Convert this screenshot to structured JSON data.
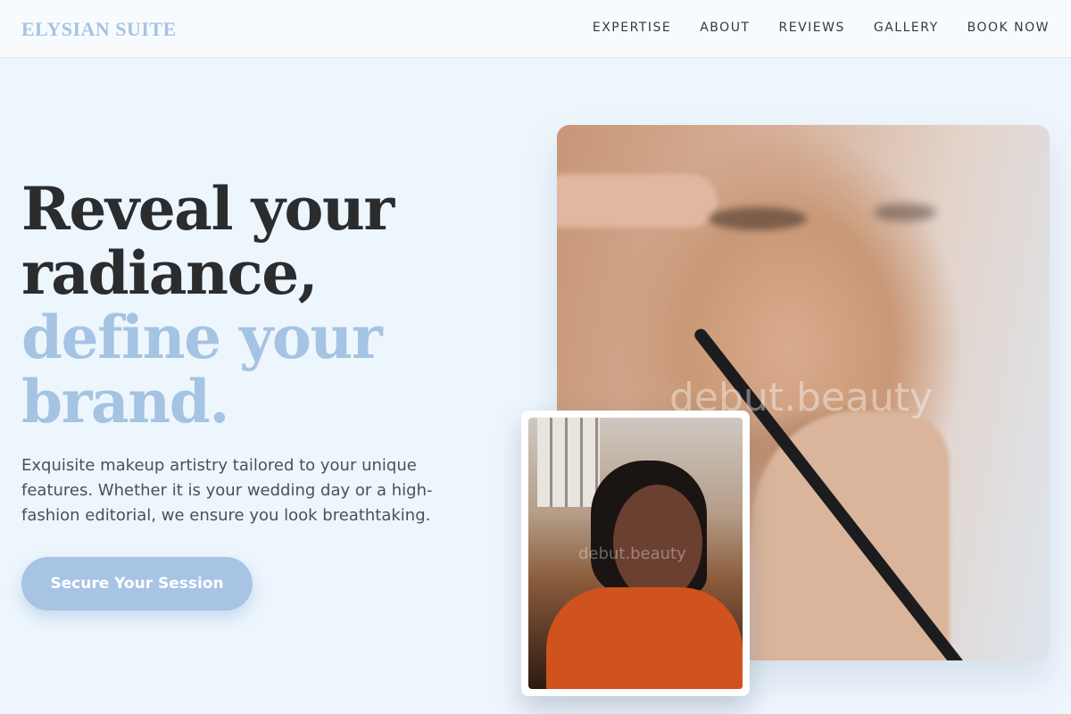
{
  "brand": {
    "logo_text": "ELYSIAN SUITE"
  },
  "nav": {
    "items": [
      {
        "label": "EXPERTISE"
      },
      {
        "label": "ABOUT"
      },
      {
        "label": "REVIEWS"
      },
      {
        "label": "GALLERY"
      },
      {
        "label": "BOOK NOW"
      }
    ]
  },
  "hero": {
    "title_line1": "Reveal your",
    "title_line2": "radiance,",
    "title_line3": "define your",
    "title_line4": "brand.",
    "description": "Exquisite makeup artistry tailored to your unique features. Whether it is your wedding day or a high-fashion editorial, we ensure you look breathtaking.",
    "cta_label": "Secure Your Session"
  },
  "images": {
    "main_watermark": "debut.beauty",
    "secondary_watermark": "debut.beauty"
  },
  "colors": {
    "accent": "#a7c4e5",
    "heading_dark": "#2a2c2e",
    "background": "#eef6fd"
  }
}
